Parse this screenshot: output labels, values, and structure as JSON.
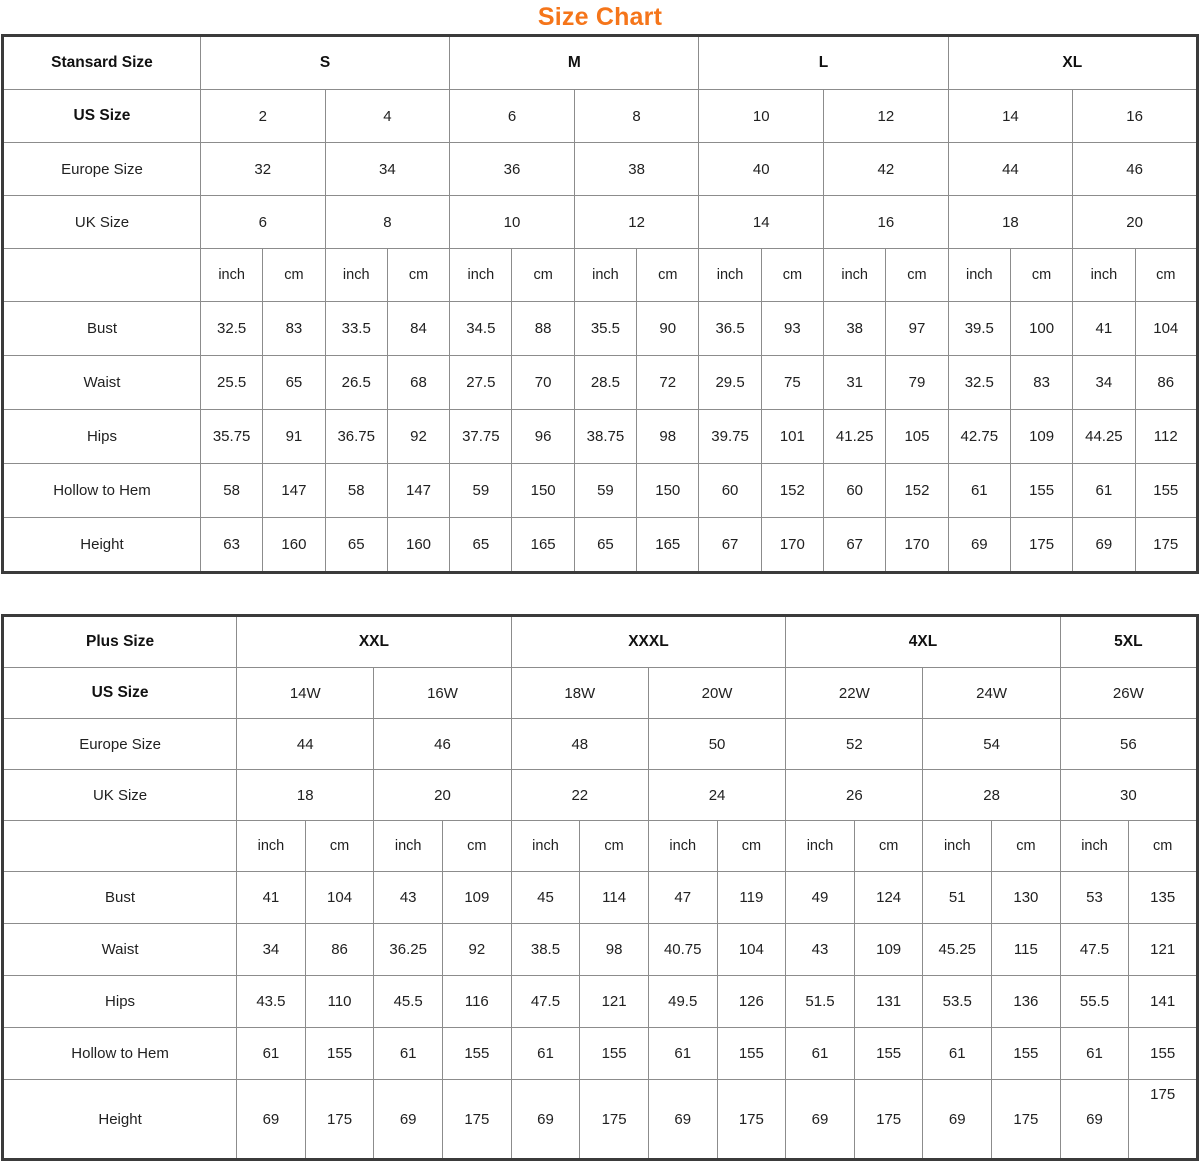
{
  "title": "Size Chart",
  "accent_color": "#f5751a",
  "border_color": "#3b3b3b",
  "grid_color": "#8c8c8c",
  "tables": [
    {
      "name": "standard-size-table",
      "corner_label": "Stansard Size",
      "group_headers": [
        "S",
        "M",
        "L",
        "XL"
      ],
      "row_labels": [
        "US Size",
        "Europe Size",
        "UK Size",
        "Bust",
        "Waist",
        "Hips",
        "Hollow to Hem",
        "Height"
      ],
      "unit_labels": [
        "inch",
        "cm"
      ],
      "size_rows": [
        {
          "label": "US Size",
          "values": [
            "2",
            "4",
            "6",
            "8",
            "10",
            "12",
            "14",
            "16"
          ]
        },
        {
          "label": "Europe Size",
          "values": [
            "32",
            "34",
            "36",
            "38",
            "40",
            "42",
            "44",
            "46"
          ]
        },
        {
          "label": "UK Size",
          "values": [
            "6",
            "8",
            "10",
            "12",
            "14",
            "16",
            "18",
            "20"
          ]
        }
      ],
      "measure_rows": [
        {
          "label": "Bust",
          "values": [
            "32.5",
            "83",
            "33.5",
            "84",
            "34.5",
            "88",
            "35.5",
            "90",
            "36.5",
            "93",
            "38",
            "97",
            "39.5",
            "100",
            "41",
            "104"
          ]
        },
        {
          "label": "Waist",
          "values": [
            "25.5",
            "65",
            "26.5",
            "68",
            "27.5",
            "70",
            "28.5",
            "72",
            "29.5",
            "75",
            "31",
            "79",
            "32.5",
            "83",
            "34",
            "86"
          ]
        },
        {
          "label": "Hips",
          "values": [
            "35.75",
            "91",
            "36.75",
            "92",
            "37.75",
            "96",
            "38.75",
            "98",
            "39.75",
            "101",
            "41.25",
            "105",
            "42.75",
            "109",
            "44.25",
            "112"
          ]
        },
        {
          "label": "Hollow to Hem",
          "values": [
            "58",
            "147",
            "58",
            "147",
            "59",
            "150",
            "59",
            "150",
            "60",
            "152",
            "60",
            "152",
            "61",
            "155",
            "61",
            "155"
          ]
        },
        {
          "label": "Height",
          "values": [
            "63",
            "160",
            "65",
            "160",
            "65",
            "165",
            "65",
            "165",
            "67",
            "170",
            "67",
            "170",
            "69",
            "175",
            "69",
            "175"
          ]
        }
      ]
    },
    {
      "name": "plus-size-table",
      "corner_label": "Plus Size",
      "group_headers": [
        "XXL",
        "XXXL",
        "4XL",
        "5XL"
      ],
      "unit_labels": [
        "inch",
        "cm"
      ],
      "size_rows": [
        {
          "label": "US Size",
          "values": [
            "14W",
            "16W",
            "18W",
            "20W",
            "22W",
            "24W",
            "26W"
          ]
        },
        {
          "label": "Europe Size",
          "values": [
            "44",
            "46",
            "48",
            "50",
            "52",
            "54",
            "56"
          ]
        },
        {
          "label": "UK Size",
          "values": [
            "18",
            "20",
            "22",
            "24",
            "26",
            "28",
            "30"
          ]
        }
      ],
      "measure_rows": [
        {
          "label": "Bust",
          "values": [
            "41",
            "104",
            "43",
            "109",
            "45",
            "114",
            "47",
            "119",
            "49",
            "124",
            "51",
            "130",
            "53",
            "135"
          ]
        },
        {
          "label": "Waist",
          "values": [
            "34",
            "86",
            "36.25",
            "92",
            "38.5",
            "98",
            "40.75",
            "104",
            "43",
            "109",
            "45.25",
            "115",
            "47.5",
            "121"
          ]
        },
        {
          "label": "Hips",
          "values": [
            "43.5",
            "110",
            "45.5",
            "116",
            "47.5",
            "121",
            "49.5",
            "126",
            "51.5",
            "131",
            "53.5",
            "136",
            "55.5",
            "141"
          ]
        },
        {
          "label": "Hollow to Hem",
          "values": [
            "61",
            "155",
            "61",
            "155",
            "61",
            "155",
            "61",
            "155",
            "61",
            "155",
            "61",
            "155",
            "61",
            "155"
          ]
        },
        {
          "label": "Height",
          "values": [
            "69",
            "175",
            "69",
            "175",
            "69",
            "175",
            "69",
            "175",
            "69",
            "175",
            "69",
            "175",
            "69",
            "175"
          ]
        }
      ]
    }
  ]
}
